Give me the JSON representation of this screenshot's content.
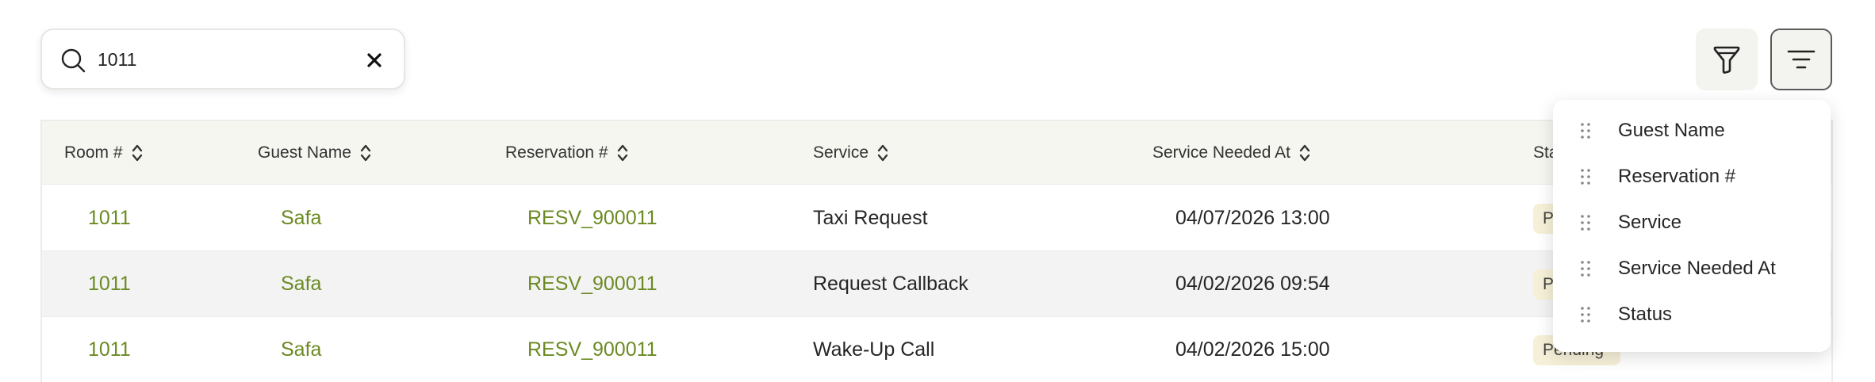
{
  "search": {
    "value": "1011",
    "icon": "search-icon",
    "clear_icon": "close-icon"
  },
  "toolbar": {
    "filter_icon": "filter-icon",
    "columns_icon": "sort-lines-icon"
  },
  "table": {
    "columns": [
      "Room #",
      "Guest Name",
      "Reservation #",
      "Service",
      "Service Needed At",
      "Sta"
    ],
    "rows": [
      {
        "room": "1011",
        "guest": "Safa",
        "reservation": "RESV_900011",
        "service": "Taxi Request",
        "needed_at": "04/07/2026 13:00",
        "status": "P"
      },
      {
        "room": "1011",
        "guest": "Safa",
        "reservation": "RESV_900011",
        "service": "Request Callback",
        "needed_at": "04/02/2026 09:54",
        "status": "P"
      },
      {
        "room": "1011",
        "guest": "Safa",
        "reservation": "RESV_900011",
        "service": "Wake-Up Call",
        "needed_at": "04/02/2026 15:00",
        "status": "Pending"
      }
    ]
  },
  "column_menu": {
    "items": [
      "Guest Name",
      "Reservation #",
      "Service",
      "Service Needed At",
      "Status"
    ]
  },
  "colors": {
    "accent_link": "#6b8a22",
    "badge_bg": "#f6f0d8",
    "header_bg": "#f6f6f1"
  }
}
